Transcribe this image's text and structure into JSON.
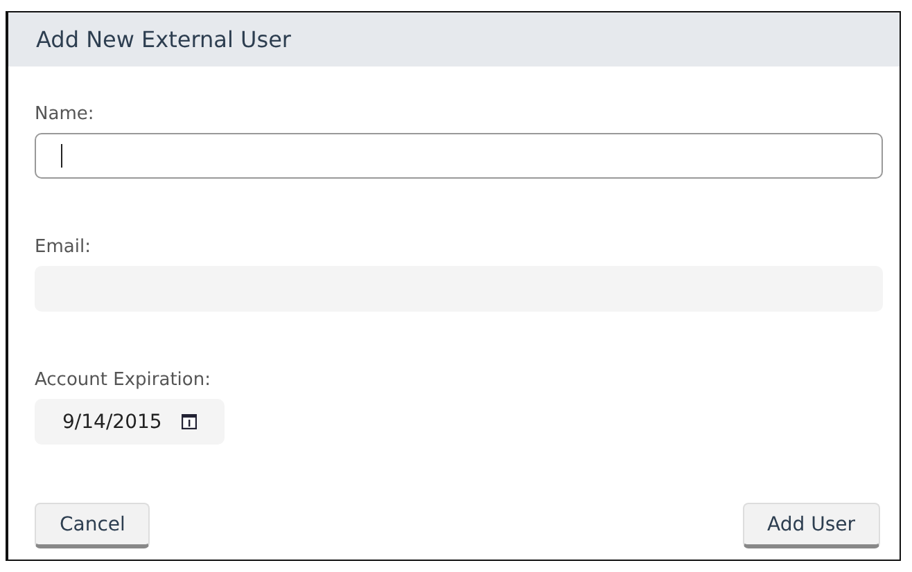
{
  "dialog": {
    "title": "Add New External User"
  },
  "fields": [
    {
      "kind": "text",
      "label": "Name:",
      "focused": true
    },
    {
      "kind": "text",
      "label": "Email:",
      "focused": false
    },
    {
      "kind": "date",
      "label": "Account Expiration:",
      "value": "9/14/2015"
    }
  ],
  "buttons": [
    "Cancel",
    "Add User"
  ]
}
